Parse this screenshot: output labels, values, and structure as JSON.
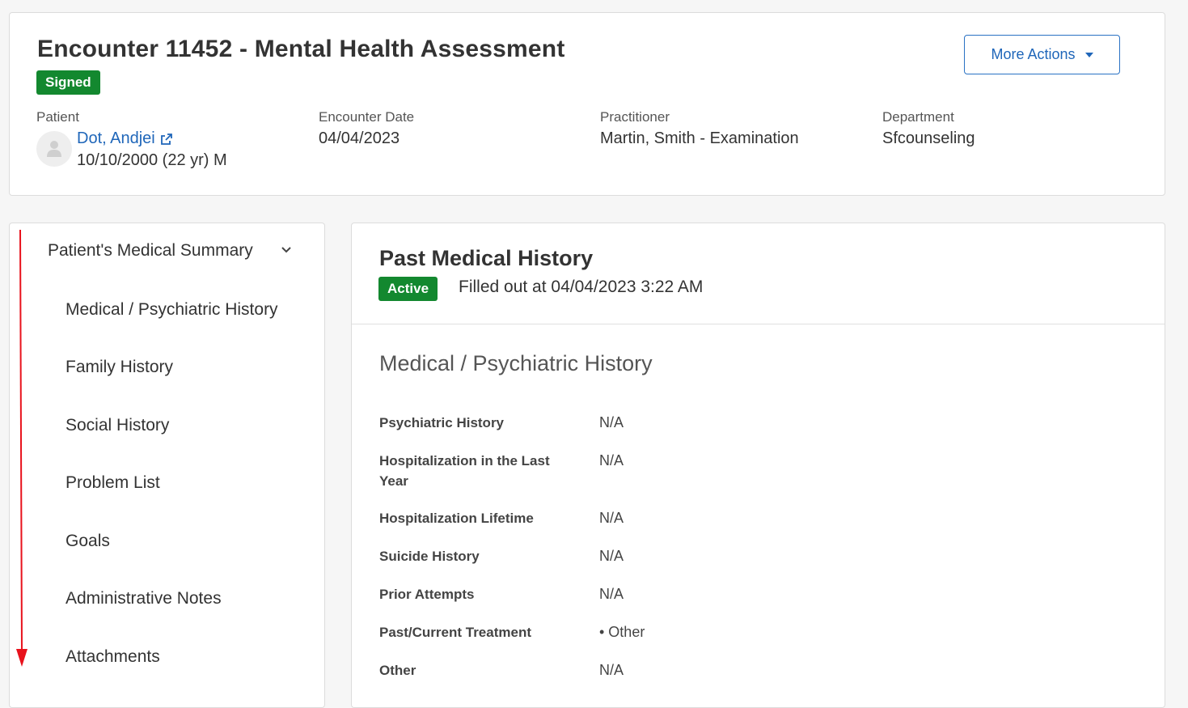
{
  "header": {
    "title": "Encounter 11452 - Mental Health Assessment",
    "status": "Signed",
    "more_actions_label": "More Actions",
    "patient": {
      "label": "Patient",
      "name": "Dot, Andjei",
      "dob": "10/10/2000 (22 yr) M"
    },
    "encounter_date": {
      "label": "Encounter Date",
      "value": "04/04/2023"
    },
    "practitioner": {
      "label": "Practitioner",
      "value": "Martin, Smith - Examination"
    },
    "department": {
      "label": "Department",
      "value": "Sfcounseling"
    }
  },
  "sidebar": {
    "title": "Patient's Medical Summary",
    "items": [
      "Medical / Psychiatric History",
      "Family History",
      "Social History",
      "Problem List",
      "Goals",
      "Administrative Notes",
      "Attachments"
    ]
  },
  "main": {
    "title": "Past Medical History",
    "status": "Active",
    "filled_out": "Filled out at 04/04/2023 3:22 AM",
    "section_title": "Medical / Psychiatric History",
    "fields": [
      {
        "label": "Psychiatric History",
        "value": "N/A"
      },
      {
        "label": "Hospitalization in the Last Year",
        "value": "N/A"
      },
      {
        "label": "Hospitalization Lifetime",
        "value": "N/A"
      },
      {
        "label": "Suicide History",
        "value": "N/A"
      },
      {
        "label": "Prior Attempts",
        "value": "N/A"
      },
      {
        "label": "Past/Current Treatment",
        "value": "• Other"
      },
      {
        "label": "Other",
        "value": "N/A"
      }
    ]
  },
  "colors": {
    "badge_green": "#13882f",
    "link_blue": "#1f66b9",
    "annotation_red": "#e8121c"
  }
}
